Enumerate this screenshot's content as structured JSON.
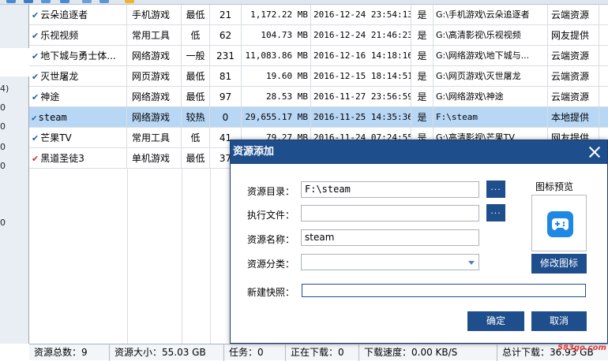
{
  "sidebar": {
    "nums": [
      "4)",
      "0",
      "0",
      "0",
      "0",
      "0"
    ]
  },
  "table": {
    "rows": [
      {
        "name": "云朵追逐者",
        "category": "手机游戏",
        "priority": "最低",
        "count": "21",
        "size": "1,172.22 MB",
        "time": "2016-12-24 23:54:13",
        "flag": "是",
        "path": "G:\\手机游戏\\云朵追逐者",
        "source": "云端资源",
        "check": "✔"
      },
      {
        "name": "乐视视频",
        "category": "常用工具",
        "priority": "低",
        "count": "62",
        "size": "104.73 MB",
        "time": "2016-12-24 21:46:23",
        "flag": "是",
        "path": "G:\\高清影视\\乐视视频",
        "source": "网友提供",
        "check": "✔"
      },
      {
        "name": "地下城与勇士体...",
        "category": "网络游戏",
        "priority": "一般",
        "count": "231",
        "size": "11,083.86 MB",
        "time": "2016-12-16 14:18:16",
        "flag": "是",
        "path": "G:\\网络游戏\\地下城与...",
        "source": "云端资源",
        "check": "✔"
      },
      {
        "name": "灭世屠龙",
        "category": "网页游戏",
        "priority": "最低",
        "count": "81",
        "size": "19.60 MB",
        "time": "2016-12-15 18:14:51",
        "flag": "是",
        "path": "G:\\网页游戏\\灭世屠龙",
        "source": "云端资源",
        "check": "✔"
      },
      {
        "name": "神途",
        "category": "网络游戏",
        "priority": "最低",
        "count": "97",
        "size": "28.53 MB",
        "time": "2016-11-27 23:56:59",
        "flag": "是",
        "path": "G:\\网络游戏\\神途",
        "source": "云端资源",
        "check": "✔"
      },
      {
        "name": "steam",
        "category": "网络游戏",
        "priority": "较热",
        "count": "0",
        "size": "29,655.17 MB",
        "time": "2016-11-25 14:35:36",
        "flag": "是",
        "path": "F:\\steam",
        "source": "本地提供",
        "check": "✔"
      },
      {
        "name": "芒果TV",
        "category": "常用工具",
        "priority": "低",
        "count": "41",
        "size": "79.27 MB",
        "time": "2016-11-24 07:24:55",
        "flag": "是",
        "path": "G:\\高清影视\\芒果TV",
        "source": "网友提供",
        "check": "✔"
      },
      {
        "name": "黑道圣徒3",
        "category": "单机游戏",
        "priority": "最低",
        "count": "37",
        "size": "",
        "time": "",
        "flag": "",
        "path": "",
        "source": "",
        "check": "✔"
      }
    ]
  },
  "status": {
    "total": "资源总数：9",
    "size": "资源大小：55.03 GB",
    "tasks": "任务：0",
    "downloading": "正在下载：0",
    "speed": "下载速度：0.00 KB/S",
    "total_download": "总计下载：36.93 GB"
  },
  "dialog": {
    "title": "资源添加",
    "dir_label": "资源目录：",
    "dir_value": "F:\\steam",
    "exe_label": "执行文件：",
    "exe_value": "",
    "name_label": "资源名称：",
    "name_value": "steam",
    "cat_label": "资源分类：",
    "cat_value": "",
    "snap_label": "新建快照：",
    "snap_value": "",
    "browse": "...",
    "preview_label": "图标预览",
    "modify_icon": "修改图标",
    "ok": "确定",
    "cancel": "取消"
  },
  "watermark": "583go.com",
  "colors": {
    "accent": "#1f4e8c",
    "selected_row": "#b8d7f5",
    "icon_blue": "#1e88e5"
  }
}
